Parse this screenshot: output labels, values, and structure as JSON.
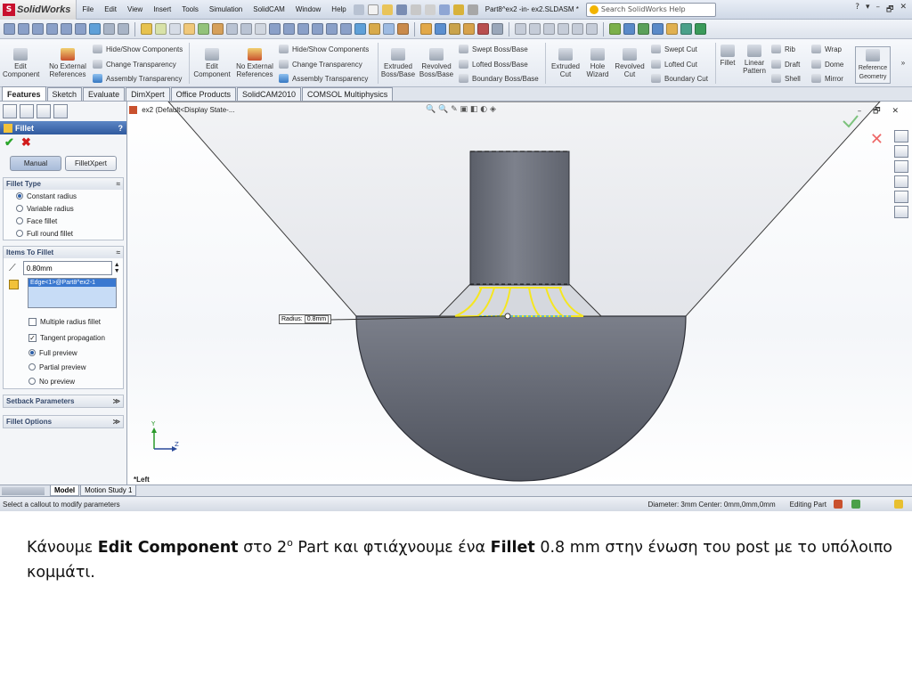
{
  "window": {
    "brand": "SolidWorks",
    "menus": [
      "File",
      "Edit",
      "View",
      "Insert",
      "Tools",
      "Simulation",
      "SolidCAM",
      "Window",
      "Help"
    ],
    "doc_title": "Part8^ex2 -in- ex2.SLDASM *",
    "search_placeholder": "Search SolidWorks Help",
    "controls": [
      "?",
      "▾",
      "–",
      "🗗",
      "✕"
    ]
  },
  "command_manager": {
    "edit_component": "Edit Component",
    "no_external_references": "No External References",
    "hide_show_components": "Hide/Show Components",
    "change_transparency": "Change Transparency",
    "assembly_transparency": "Assembly Transparency",
    "extruded_boss": "Extruded Boss/Base",
    "revolved_boss": "Revolved Boss/Base",
    "swept_boss": "Swept Boss/Base",
    "lofted_boss": "Lofted Boss/Base",
    "boundary_boss": "Boundary Boss/Base",
    "extruded_cut": "Extruded Cut",
    "hole_wizard": "Hole Wizard",
    "revolved_cut": "Revolved Cut",
    "swept_cut": "Swept Cut",
    "lofted_cut": "Lofted Cut",
    "boundary_cut": "Boundary Cut",
    "fillet": "Fillet",
    "linear_pattern": "Linear Pattern",
    "rib": "Rib",
    "draft": "Draft",
    "shell": "Shell",
    "wrap": "Wrap",
    "dome": "Dome",
    "mirror": "Mirror",
    "reference_geometry": "Reference Geometry",
    "more": "»"
  },
  "tabs": [
    "Features",
    "Sketch",
    "Evaluate",
    "DimXpert",
    "Office Products",
    "SolidCAM2010",
    "COMSOL Multiphysics"
  ],
  "property_manager": {
    "title": "Fillet",
    "help": "?",
    "ok_icon": "✔",
    "cancel_icon": "✖",
    "mode_manual": "Manual",
    "mode_filletxpert": "FilletXpert",
    "fillet_type": {
      "header": "Fillet Type",
      "options": [
        "Constant radius",
        "Variable radius",
        "Face fillet",
        "Full round fillet"
      ],
      "selected_index": 0
    },
    "items_to_fillet": {
      "header": "Items To Fillet",
      "radius_value": "0.80mm",
      "edge_item": "Edge<1>@Part8^ex2-1",
      "multiple_radius": "Multiple radius fillet",
      "tangent_propagation": "Tangent propagation",
      "tangent_checked_mark": "✓",
      "full_preview": "Full preview",
      "partial_preview": "Partial preview",
      "no_preview": "No preview"
    },
    "setback_parameters": "Setback Parameters",
    "fillet_options": "Fillet Options",
    "collapse_up": "≈",
    "collapse_down": "≫"
  },
  "graphics": {
    "tree_node": "ex2  (Default<Display State-...",
    "callout_label": "Radius:",
    "callout_value": "0.8mm",
    "view_name": "*Left",
    "triad_y": "Y",
    "triad_z": "Z",
    "heads_up": "🔍 🔍 ✎ ▣ ◧ ◐ ◈"
  },
  "bottom_tabs": [
    "Model",
    "Motion Study 1"
  ],
  "status": {
    "message": "Select a callout to modify parameters",
    "measure": "Diameter: 3mm  Center: 0mm,0mm,0mm",
    "mode": "Editing Part"
  },
  "caption": {
    "line_part1": "Κάνουμε ",
    "bold1": "Edit Component",
    "line_part2": " στο 2",
    "superscript": "ο",
    "line_part3": " Part και φτιάχνουμε ένα ",
    "bold2": "Fillet",
    "line_part4": " 0.8 mm στην ένωση του post με το υπόλοιπο κομμάτι."
  }
}
